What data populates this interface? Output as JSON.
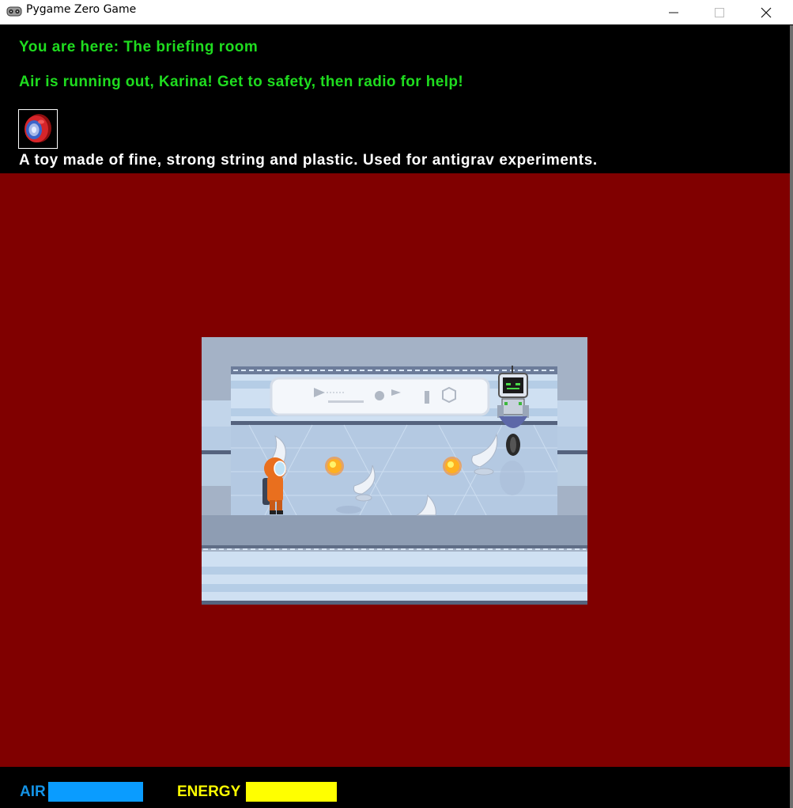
{
  "window": {
    "title": "Pygame Zero Game",
    "icon": "gamepad-icon",
    "controls": [
      "minimize-icon",
      "maximize-icon",
      "close-icon"
    ]
  },
  "hud": {
    "location_text": "You are here: The briefing room",
    "warning_text": "Air is running out, Karina! Get to safety, then radio for help!",
    "selected_item": {
      "icon": "yoyo-icon",
      "description": "A toy made of fine, strong string and plastic. Used for antigrav experiments."
    },
    "air": {
      "label": "AIR",
      "level": 1.0,
      "color": "#0a9cff"
    },
    "energy": {
      "label": "ENERGY",
      "level": 1.0,
      "color": "#ffff00"
    }
  },
  "scene": {
    "room_name": "The briefing room",
    "background_color": "#800000",
    "characters": [
      "astronaut-karina",
      "robot"
    ],
    "objects": [
      "briefing-screen",
      "egg-chair",
      "egg-chair",
      "egg-chair",
      "egg-chair",
      "energy-ball",
      "energy-ball"
    ]
  }
}
